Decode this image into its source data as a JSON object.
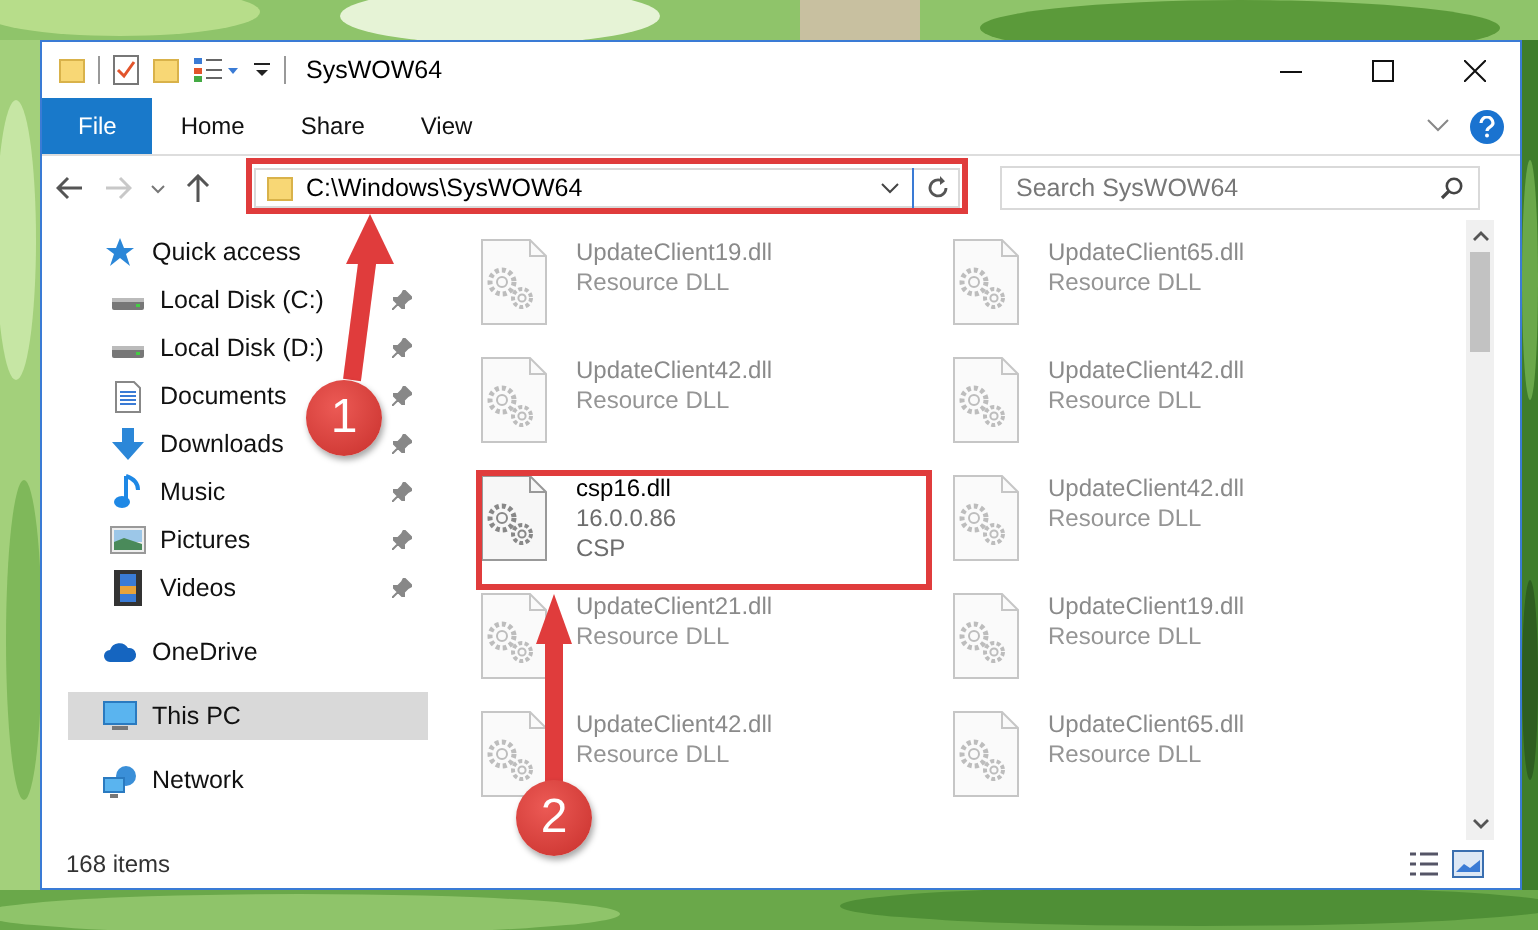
{
  "window": {
    "title": "SysWOW64"
  },
  "ribbon_tabs": [
    {
      "label": "File",
      "selected": true
    },
    {
      "label": "Home",
      "selected": false
    },
    {
      "label": "Share",
      "selected": false
    },
    {
      "label": "View",
      "selected": false
    }
  ],
  "address": {
    "path": "C:\\Windows\\SysWOW64"
  },
  "search": {
    "placeholder": "Search SysWOW64"
  },
  "sidebar": {
    "items": [
      {
        "label": "Quick access",
        "kind": "star",
        "pinned": false,
        "selected": false,
        "children": [
          {
            "label": "Local Disk (C:)",
            "kind": "drive",
            "pinned": true,
            "selected": false
          },
          {
            "label": "Local Disk (D:)",
            "kind": "drive",
            "pinned": true,
            "selected": false
          },
          {
            "label": "Documents",
            "kind": "document",
            "pinned": true,
            "selected": false
          },
          {
            "label": "Downloads",
            "kind": "download",
            "pinned": true,
            "selected": false
          },
          {
            "label": "Music",
            "kind": "music",
            "pinned": true,
            "selected": false
          },
          {
            "label": "Pictures",
            "kind": "pictures",
            "pinned": true,
            "selected": false
          },
          {
            "label": "Videos",
            "kind": "videos",
            "pinned": true,
            "selected": false
          }
        ]
      },
      {
        "label": "OneDrive",
        "kind": "cloud",
        "pinned": false,
        "selected": false
      },
      {
        "label": "This PC",
        "kind": "computer",
        "pinned": false,
        "selected": true
      },
      {
        "label": "Network",
        "kind": "network",
        "pinned": false,
        "selected": false
      }
    ]
  },
  "files": [
    {
      "name": "UpdateClient19.dll",
      "details": [
        "Resource DLL"
      ],
      "kind": "blurred"
    },
    {
      "name": "UpdateClient65.dll",
      "details": [
        "Resource DLL"
      ],
      "kind": "blurred"
    },
    {
      "name": "UpdateClient42.dll",
      "details": [
        "Resource DLL"
      ],
      "kind": "blurred"
    },
    {
      "name": "UpdateClient42.dll",
      "details": [
        "Resource DLL"
      ],
      "kind": "blurred"
    },
    {
      "name": "csp16.dll",
      "details": [
        "16.0.0.86",
        "CSP"
      ],
      "kind": "highlighted"
    },
    {
      "name": "UpdateClient42.dll",
      "details": [
        "Resource DLL"
      ],
      "kind": "blurred"
    },
    {
      "name": "UpdateClient21.dll",
      "details": [
        "Resource DLL"
      ],
      "kind": "blurred"
    },
    {
      "name": "UpdateClient19.dll",
      "details": [
        "Resource DLL"
      ],
      "kind": "blurred"
    },
    {
      "name": "UpdateClient42.dll",
      "details": [
        "Resource DLL"
      ],
      "kind": "blurred"
    },
    {
      "name": "UpdateClient65.dll",
      "details": [
        "Resource DLL"
      ],
      "kind": "blurred"
    }
  ],
  "status_bar": {
    "item_count": "168 items"
  },
  "annotations": [
    {
      "number": "1"
    },
    {
      "number": "2"
    }
  ]
}
